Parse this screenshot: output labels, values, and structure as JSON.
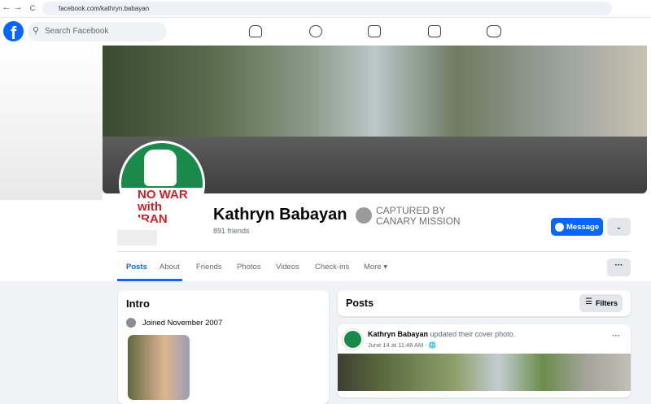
{
  "browser": {
    "url": "facebook.com/kathryn.babayan",
    "back": "←",
    "forward": "→",
    "reload": "C"
  },
  "fb": {
    "logo": "f",
    "search_placeholder": "Search Facebook",
    "nav_icons": [
      "home-icon",
      "friends-icon",
      "video-icon",
      "marketplace-icon",
      "gaming-icon"
    ]
  },
  "profile": {
    "name": "Kathryn Babayan",
    "friends": "891 friends",
    "avatar_text": "NO WAR with IRAN",
    "watermark_line1": "CAPTURED BY",
    "watermark_line2": "CANARY MISSION",
    "message": "Message",
    "dropdown": "⌄"
  },
  "tabs": [
    "Posts",
    "About",
    "Friends",
    "Photos",
    "Videos",
    "Check-ins",
    "More ▾"
  ],
  "more_dots": "···",
  "intro": {
    "title": "Intro",
    "joined": "Joined November 2007"
  },
  "posts": {
    "title": "Posts",
    "filters": "Filters",
    "post": {
      "author": "Kathryn Babayan",
      "action": "updated their cover photo.",
      "time": "June 14 at 11:48 AM · 🌐",
      "dots": "···"
    }
  },
  "colors": {
    "brand": "#0866ff",
    "background": "#f0f2f5"
  }
}
